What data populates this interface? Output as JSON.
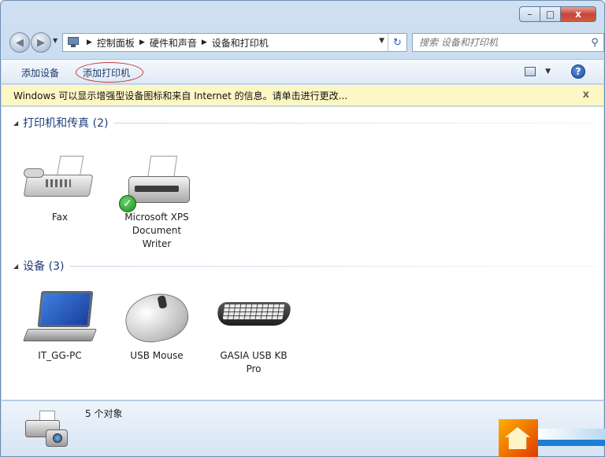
{
  "window": {
    "caption_buttons": {
      "minimize": "–",
      "maximize": "□",
      "close": "x"
    }
  },
  "nav": {
    "back_icon": "back-arrow-icon",
    "forward_icon": "forward-arrow-icon",
    "breadcrumb": [
      "控制面板",
      "硬件和声音",
      "设备和打印机"
    ],
    "search_placeholder": "搜索 设备和打印机"
  },
  "command_bar": {
    "add_device": "添加设备",
    "add_printer": "添加打印机",
    "highlight_color": "#c23a3a"
  },
  "info_bar": {
    "text": "Windows 可以显示增强型设备图标和来自 Internet 的信息。请单击进行更改...",
    "close": "x",
    "background": "#fcf7c4"
  },
  "groups": [
    {
      "title": "打印机和传真 (2)",
      "devices": [
        {
          "label_lines": [
            "Fax"
          ],
          "icon": "fax-icon"
        },
        {
          "label_lines": [
            "Microsoft XPS",
            "Document",
            "Writer"
          ],
          "icon": "printer-icon",
          "default": true
        }
      ]
    },
    {
      "title": "设备 (3)",
      "devices": [
        {
          "label_lines": [
            "IT_GG-PC"
          ],
          "icon": "laptop-icon"
        },
        {
          "label_lines": [
            "USB Mouse"
          ],
          "icon": "mouse-icon"
        },
        {
          "label_lines": [
            "GASIA USB KB",
            "Pro"
          ],
          "icon": "keyboard-icon"
        }
      ]
    }
  ],
  "details": {
    "count": "5 个对象"
  },
  "colors": {
    "group_title": "#1e3c78",
    "command_text": "#1e3c6a"
  }
}
